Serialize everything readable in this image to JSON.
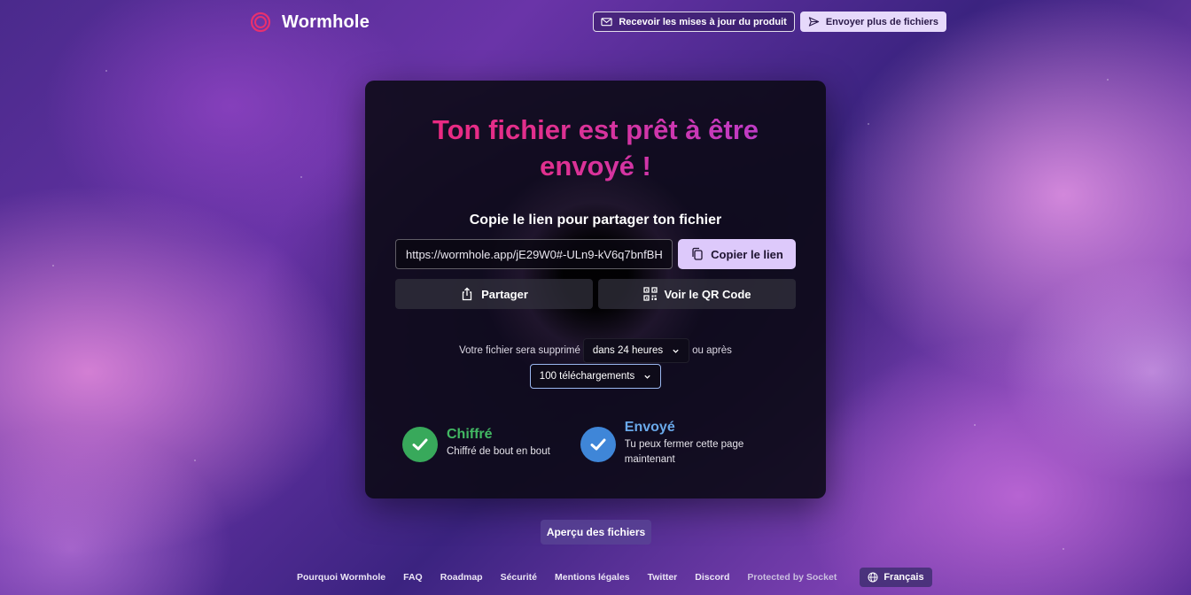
{
  "header": {
    "brand": "Wormhole",
    "updates_button": "Recevoir les mises à jour du produit",
    "send_more_button": "Envoyer plus de fichiers"
  },
  "card": {
    "title": "Ton fichier est prêt à être envoyé !",
    "subtitle": "Copie le lien pour partager ton fichier",
    "link_value": "https://wormhole.app/jE29W0#-ULn9-kV6q7bnfBH",
    "copy_button": "Copier le lien",
    "share_button": "Partager",
    "qr_button": "Voir le QR Code",
    "expiry": {
      "prefix": "Votre fichier sera supprimé",
      "time_select": "dans 24 heures",
      "middle": "ou après",
      "downloads_select": "100 téléchargements"
    },
    "features": [
      {
        "title": "Chiffré",
        "description": "Chiffré de bout en bout"
      },
      {
        "title": "Envoyé",
        "description": "Tu peux fermer cette page maintenant"
      }
    ]
  },
  "preview_button": "Aperçu des fichiers",
  "footer": {
    "links": [
      "Pourquoi Wormhole",
      "FAQ",
      "Roadmap",
      "Sécurité",
      "Mentions légales",
      "Twitter",
      "Discord",
      "Protected by Socket"
    ],
    "language": "Français"
  },
  "colors": {
    "title_gradient_start": "#f0267a",
    "title_gradient_end": "#b53fd8",
    "copy_button_bg": "#ddc9fb",
    "check_green": "#38a95b",
    "check_blue": "#3f86d8"
  },
  "icons": [
    "wormhole-logo-icon",
    "mail-icon",
    "send-icon",
    "clipboard-icon",
    "share-icon",
    "qr-code-icon",
    "chevron-down-icon",
    "checkmark-icon",
    "globe-icon"
  ]
}
